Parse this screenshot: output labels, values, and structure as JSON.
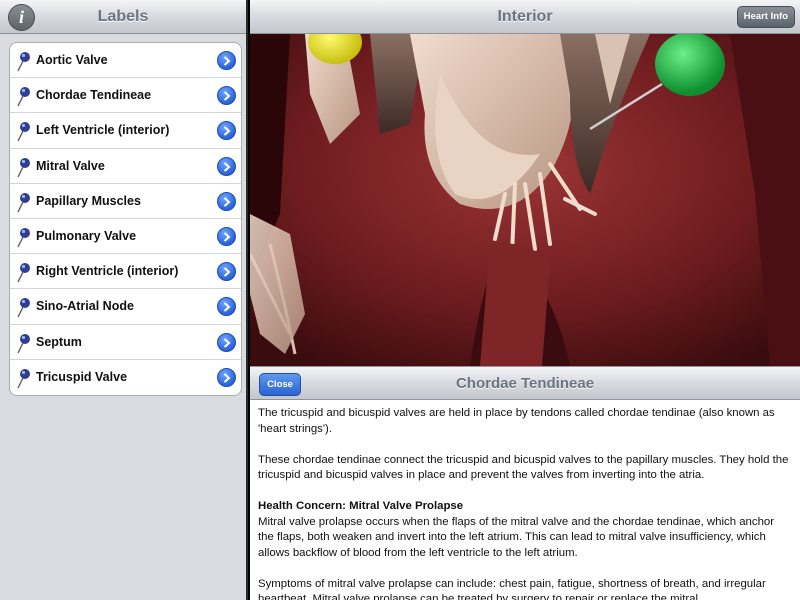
{
  "sidebar": {
    "title": "Labels",
    "info_icon": "info-icon",
    "items": [
      {
        "label": "Aortic Valve"
      },
      {
        "label": "Chordae Tendineae"
      },
      {
        "label": "Left Ventricle (interior)"
      },
      {
        "label": "Mitral Valve"
      },
      {
        "label": "Papillary Muscles"
      },
      {
        "label": "Pulmonary Valve"
      },
      {
        "label": "Right Ventricle (interior)"
      },
      {
        "label": "Sino-Atrial Node"
      },
      {
        "label": "Septum"
      },
      {
        "label": "Tricuspid Valve"
      }
    ]
  },
  "main": {
    "title": "Interior",
    "heart_info_label": "Heart Info"
  },
  "detail": {
    "close_label": "Close",
    "title": "Chordae Tendineae",
    "paragraph1": "The tricuspid and bicuspid valves are held in place by tendons called chordae tendinae (also known as 'heart strings').",
    "paragraph2": "These chordae tendinae connect the tricuspid and bicuspid valves to the papillary muscles. They hold the tricuspid and bicuspid valves in place and prevent the valves from inverting into the atria.",
    "heading": "Health Concern: Mitral Valve Prolapse",
    "paragraph3": "Mitral valve prolapse occurs when the flaps of the mitral valve and the chordae tendinae, which anchor the flaps, both weaken and invert into the left atrium. This can lead to mitral valve insufficiency, which allows backflow of blood from the left ventricle to the left atrium.",
    "paragraph4": "Symptoms of mitral valve prolapse can include: chest pain, fatigue, shortness of breath, and irregular heartbeat. Mitral valve prolapse can be treated by surgery to repair or replace the mitral"
  },
  "colors": {
    "accent_blue": "#2a63d9",
    "marker_green": "#1fb24a",
    "marker_yellow": "#e8e020",
    "tissue_red": "#7a1f22"
  }
}
